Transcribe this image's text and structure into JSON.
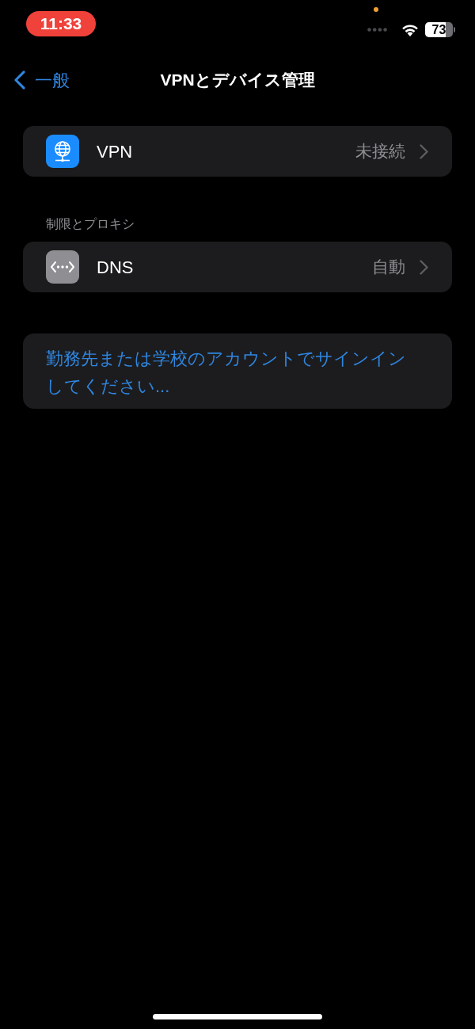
{
  "status_bar": {
    "time": "11:33",
    "battery": "73"
  },
  "nav_bar": {
    "back": "一般",
    "title": "VPNとデバイス管理"
  },
  "vpn": {
    "label": "VPN",
    "value": "未接続"
  },
  "restrictions": {
    "header": "制限とプロキシ",
    "dns": {
      "label": "DNS",
      "value": "自動"
    }
  },
  "sign_in": {
    "text": "勤務先または学校のアカウントでサインインしてください..."
  }
}
